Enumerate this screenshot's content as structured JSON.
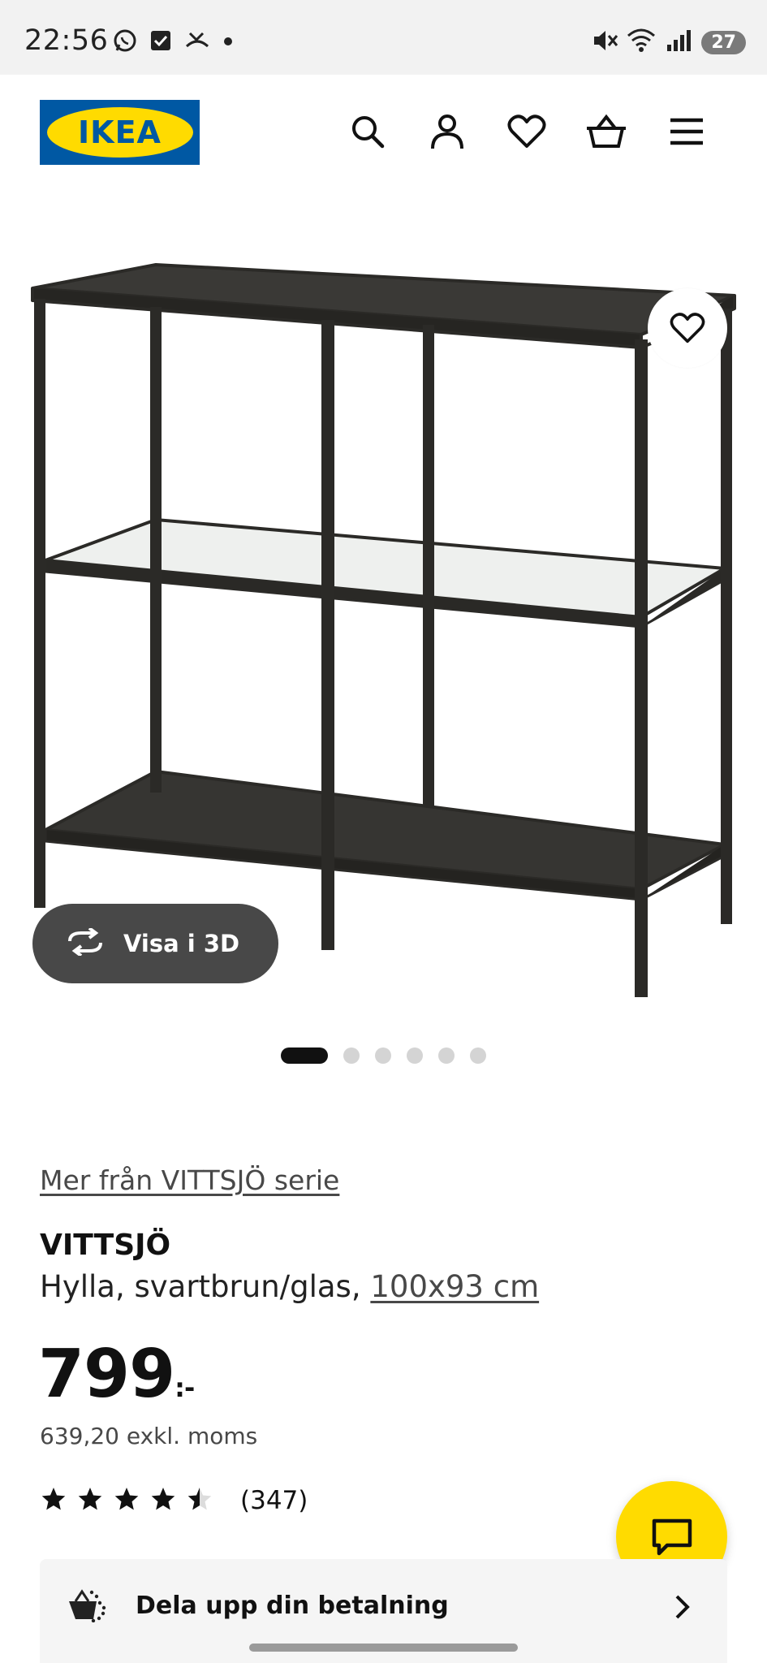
{
  "status_bar": {
    "time": "22:56",
    "battery": "27",
    "icons": [
      "whatsapp-icon",
      "check-square-icon",
      "missed-call-icon",
      "dot-icon",
      "mute-icon",
      "wifi-icon",
      "signal-icon"
    ]
  },
  "header": {
    "logo_text": "IKEA",
    "icons": [
      "search-icon",
      "account-icon",
      "heart-icon",
      "basket-icon",
      "menu-icon"
    ]
  },
  "gallery": {
    "view_3d_label": "Visa i 3D",
    "slide_count": 6,
    "active_slide": 1
  },
  "product": {
    "series_link": "Mer från VITTSJÖ serie",
    "name": "VITTSJÖ",
    "description": "Hylla, svartbrun/glas,",
    "size": "100x93 cm",
    "price": "799",
    "price_suffix": ":-",
    "price_ex_vat": "639,20 exkl. moms",
    "rating": 4.5,
    "rating_max": 5,
    "review_count": "(347)"
  },
  "payment": {
    "label": "Dela upp din betalning"
  },
  "colors": {
    "ikea_blue": "#0058a3",
    "ikea_yellow": "#ffdb00",
    "dark_button": "#484848"
  }
}
